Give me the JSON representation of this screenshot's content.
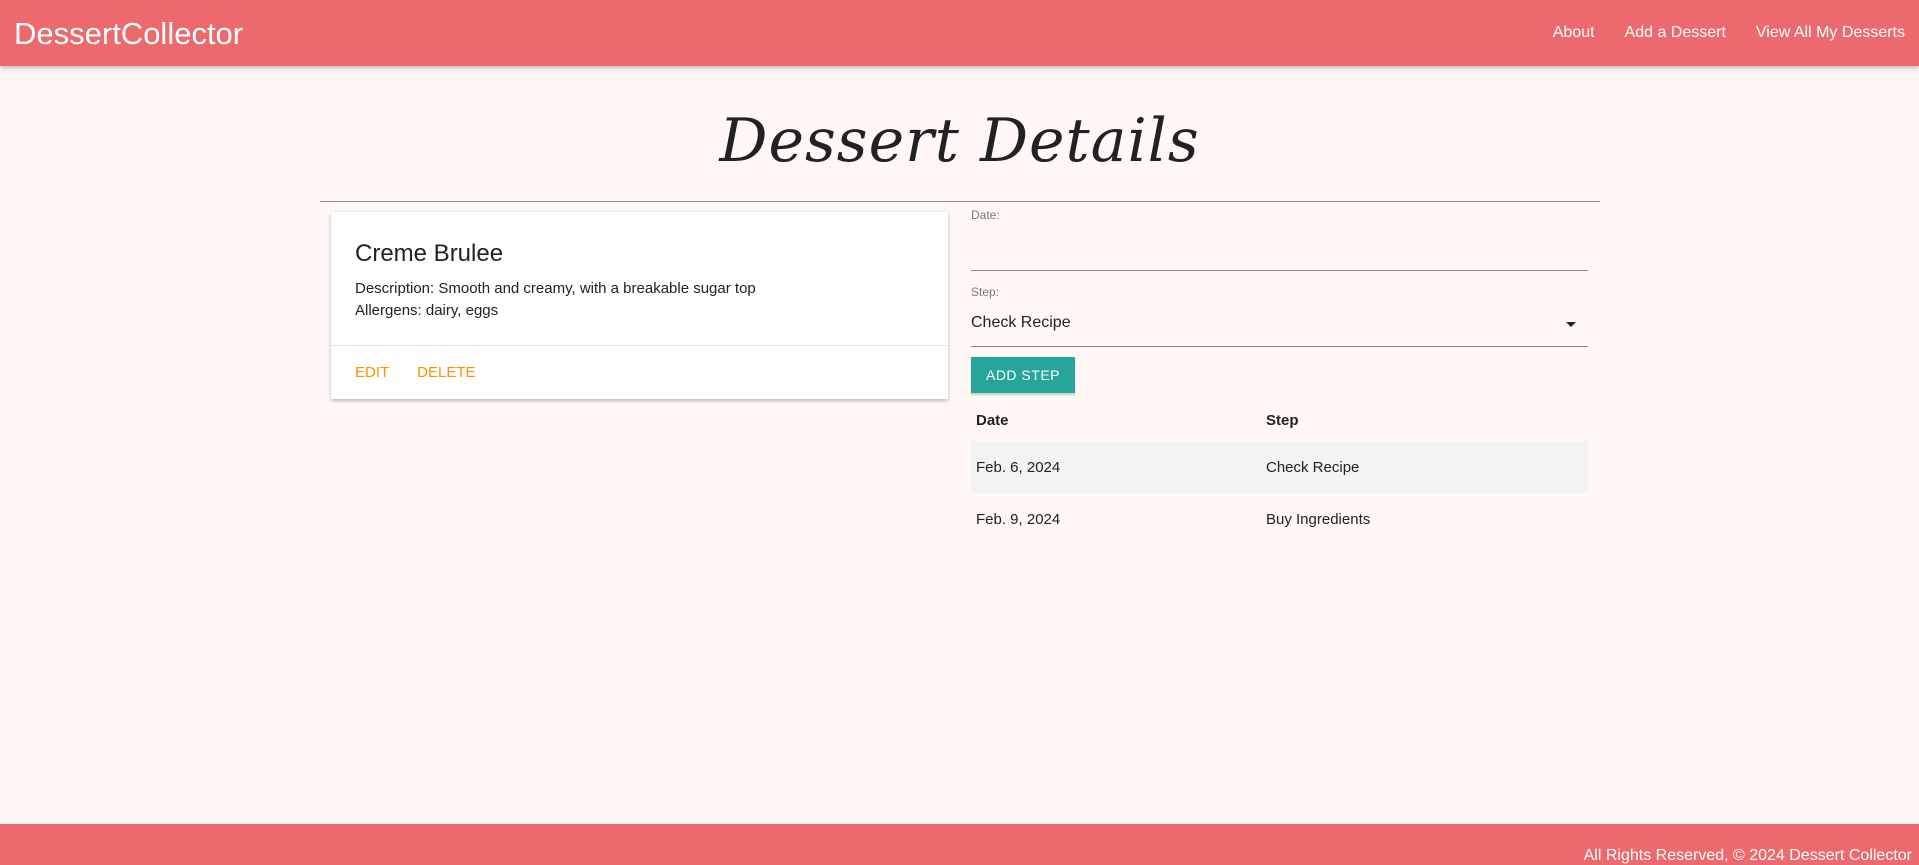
{
  "navbar": {
    "brand": "DessertCollector",
    "links": [
      "About",
      "Add a Dessert",
      "View All My Desserts"
    ]
  },
  "page": {
    "title": "Dessert Details"
  },
  "dessert": {
    "name": "Creme Brulee",
    "description": "Description: Smooth and creamy, with a breakable sugar top",
    "allergens": "Allergens: dairy, eggs",
    "actions": {
      "edit": "EDIT",
      "delete": "DELETE"
    }
  },
  "form": {
    "date_label": "Date:",
    "date_value": "",
    "step_label": "Step:",
    "step_value": "Check Recipe",
    "add_button": "ADD STEP"
  },
  "steps_table": {
    "headers": [
      "Date",
      "Step"
    ],
    "rows": [
      [
        "Feb. 6, 2024",
        "Check Recipe"
      ],
      [
        "Feb. 9, 2024",
        "Buy Ingredients"
      ]
    ]
  },
  "footer": {
    "text": "All Rights Reserved, © 2024 Dessert Collector"
  },
  "colors": {
    "navbar": "#ec6a6e",
    "background": "#fff8f7",
    "action": "#ff9100",
    "button": "#26a69a"
  }
}
